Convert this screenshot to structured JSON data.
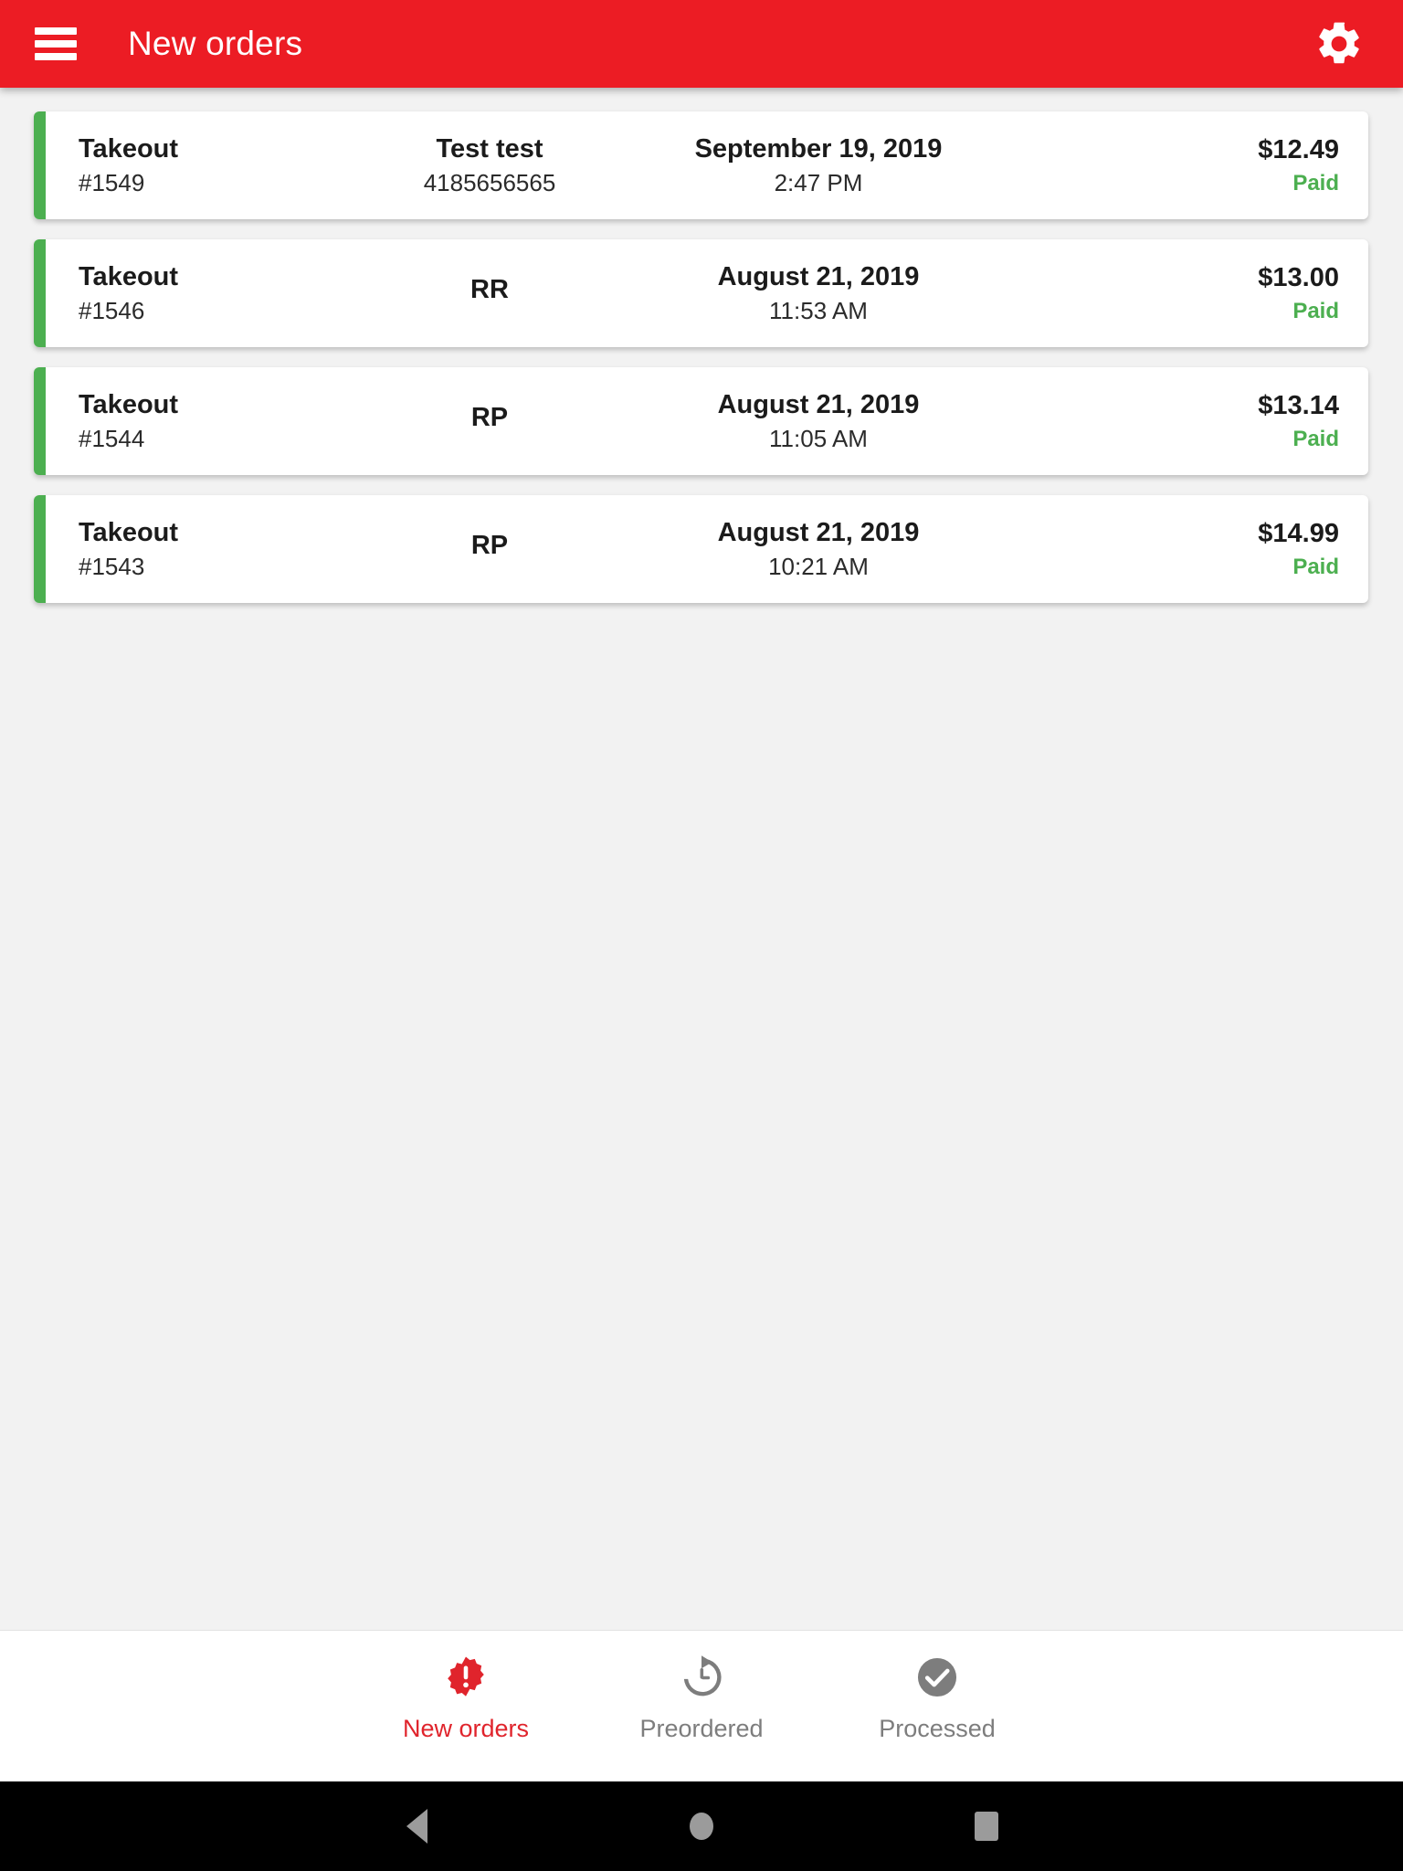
{
  "appbar": {
    "menu_icon": "hamburger-menu-icon",
    "title": "New orders",
    "settings_icon": "gear-icon",
    "background_color": "#ec1c24"
  },
  "orders": {
    "accent_color": "#4caf50",
    "items": [
      {
        "type": "Takeout",
        "number": "#1549",
        "customer": "Test test",
        "phone": "4185656565",
        "date": "September 19, 2019",
        "time": "2:47 PM",
        "amount": "$12.49",
        "status": "Paid"
      },
      {
        "type": "Takeout",
        "number": "#1546",
        "customer": "RR",
        "phone": "",
        "date": "August 21, 2019",
        "time": "11:53 AM",
        "amount": "$13.00",
        "status": "Paid"
      },
      {
        "type": "Takeout",
        "number": "#1544",
        "customer": "RP",
        "phone": "",
        "date": "August 21, 2019",
        "time": "11:05 AM",
        "amount": "$13.14",
        "status": "Paid"
      },
      {
        "type": "Takeout",
        "number": "#1543",
        "customer": "RP",
        "phone": "",
        "date": "August 21, 2019",
        "time": "10:21 AM",
        "amount": "$14.99",
        "status": "Paid"
      }
    ]
  },
  "tabbar": {
    "active_color": "#e0242c",
    "inactive_color": "#7d7d7d",
    "tabs": [
      {
        "label": "New orders",
        "icon": "alert-badge-icon",
        "active": true
      },
      {
        "label": "Preordered",
        "icon": "clock-restore-icon",
        "active": false
      },
      {
        "label": "Processed",
        "icon": "check-circle-icon",
        "active": false
      }
    ]
  },
  "system_nav": {
    "back": "back-triangle-icon",
    "home": "home-circle-icon",
    "recents": "recents-square-icon"
  }
}
